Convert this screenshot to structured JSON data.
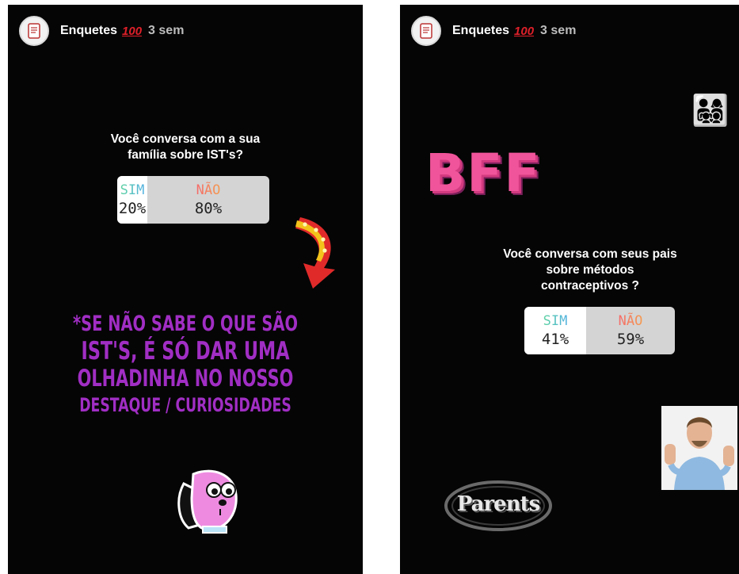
{
  "stories": [
    {
      "account": "Enquetes",
      "emoji": "💯",
      "time": "3 sem",
      "question": [
        "Você conversa com a sua",
        "família sobre IST's?"
      ],
      "poll": {
        "yes_label": "SIM",
        "yes_pct": "20%",
        "no_label": "NÃO",
        "no_pct": "80%",
        "yes_share": 0.2
      },
      "note": [
        "*SE NÃO SABE O QUE SÃO",
        "IST'S, É SÓ DAR UMA",
        "OLHADINHA NO NOSSO",
        "DESTAQUE / CURIOSIDADES"
      ],
      "stickers": [
        "arrow-sticker",
        "dog-sticker"
      ]
    },
    {
      "account": "Enquetes",
      "emoji": "💯",
      "time": "3 sem",
      "question": [
        "Você conversa com seus pais",
        "sobre métodos",
        "contraceptivos ?"
      ],
      "poll": {
        "yes_label": "SIM",
        "yes_pct": "41%",
        "no_label": "NÃO",
        "no_pct": "59%",
        "yes_share": 0.41
      },
      "bff": "BFF",
      "parents_logo": "Parents",
      "family_emoji": "👨‍👩‍👧‍👦",
      "stickers": [
        "family-emoji",
        "man-hands-up-sticker",
        "parents-logo"
      ]
    }
  ],
  "colors": {
    "background": "#050505",
    "note_purple": "#a12ec4",
    "bff_pink": "#f0549a",
    "sim_gradient": [
      "#5fd3a2",
      "#4fb0e0"
    ],
    "nao_gradient": [
      "#f56a6a",
      "#f59a4f"
    ]
  }
}
